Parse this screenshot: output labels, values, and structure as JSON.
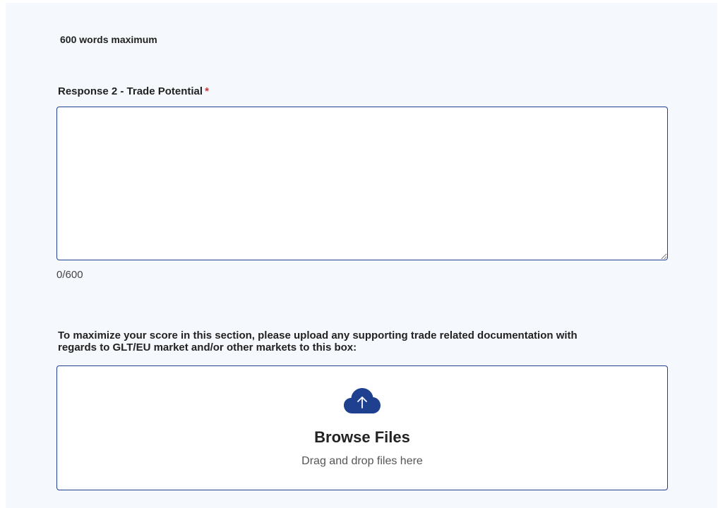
{
  "section": {
    "word_limit_note": "600 words maximum"
  },
  "response_field": {
    "label": "Response 2 - Trade Potential",
    "required_marker": "*",
    "value": "",
    "counter": "0/600"
  },
  "upload": {
    "instructions": "To maximize your score in this section, please upload any supporting trade related documentation with regards to GLT/EU market and/or other markets to this box:",
    "icon": "cloud-upload-icon",
    "browse_label": "Browse Files",
    "drag_hint": "Drag and drop files here"
  },
  "colors": {
    "accent": "#1f3f8f",
    "required": "#d13438",
    "panel_background": "#f5f8fc"
  }
}
